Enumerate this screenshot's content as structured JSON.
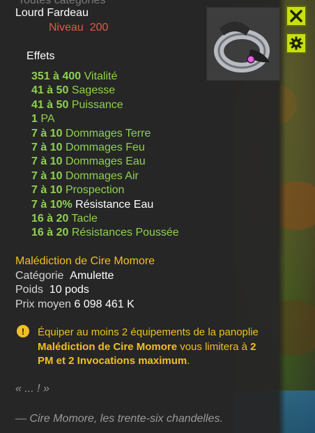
{
  "header_ghost": "Toutes catégories",
  "item": {
    "name": "Lourd Fardeau",
    "level_label": "Niveau",
    "level_value": "200",
    "icon": "ring-icon"
  },
  "effects_title": "Effets",
  "effects": [
    {
      "range": "351 à 400",
      "stat": "Vitalité"
    },
    {
      "range": "41 à 50",
      "stat": "Sagesse"
    },
    {
      "range": "41 à 50",
      "stat": "Puissance"
    },
    {
      "range": "1",
      "stat": "PA"
    },
    {
      "range": "7 à 10",
      "stat": "Dommages Terre"
    },
    {
      "range": "7 à 10",
      "stat": "Dommages Feu"
    },
    {
      "range": "7 à 10",
      "stat": "Dommages Eau"
    },
    {
      "range": "7 à 10",
      "stat": "Dommages Air"
    },
    {
      "range": "7 à 10",
      "stat": "Prospection"
    },
    {
      "range": "7 à 10%",
      "stat": "Résistance Eau"
    },
    {
      "range": "16 à 20",
      "stat": "Tacle"
    },
    {
      "range": "16 à 20",
      "stat": "Résistances Poussée"
    }
  ],
  "set_name": "Malédiction de Cire Momore",
  "category": {
    "label": "Catégorie",
    "value": "Amulette"
  },
  "weight": {
    "label": "Poids",
    "value": "10 pods"
  },
  "price": {
    "label": "Prix moyen",
    "value": "6 098 461 K"
  },
  "warning": {
    "part1": "Équiper au moins 2 équipements de la panoplie ",
    "set": "Malédiction de Cire Momore",
    "part2": " vous limitera à ",
    "limit": "2 PM et 2 Invocations maximum",
    "part3": "."
  },
  "quote": "« ... ! »",
  "quote_author": "— Cire Momore, les trente-six chandelles.",
  "buttons": {
    "close_icon": "close-icon",
    "settings_icon": "gear-icon"
  },
  "colors": {
    "bonus_green": "#8fd14f",
    "level_red": "#e05a44",
    "set_yellow": "#f0c020",
    "button_lime": "#c8e010"
  }
}
